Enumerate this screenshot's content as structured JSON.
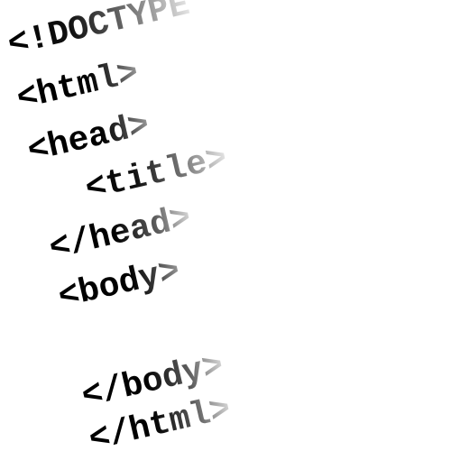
{
  "lines": [
    "<!DOCTYPE",
    "<html>",
    "<head>",
    "<title>",
    "</head>",
    "<body>",
    "</body>",
    "</html>"
  ]
}
